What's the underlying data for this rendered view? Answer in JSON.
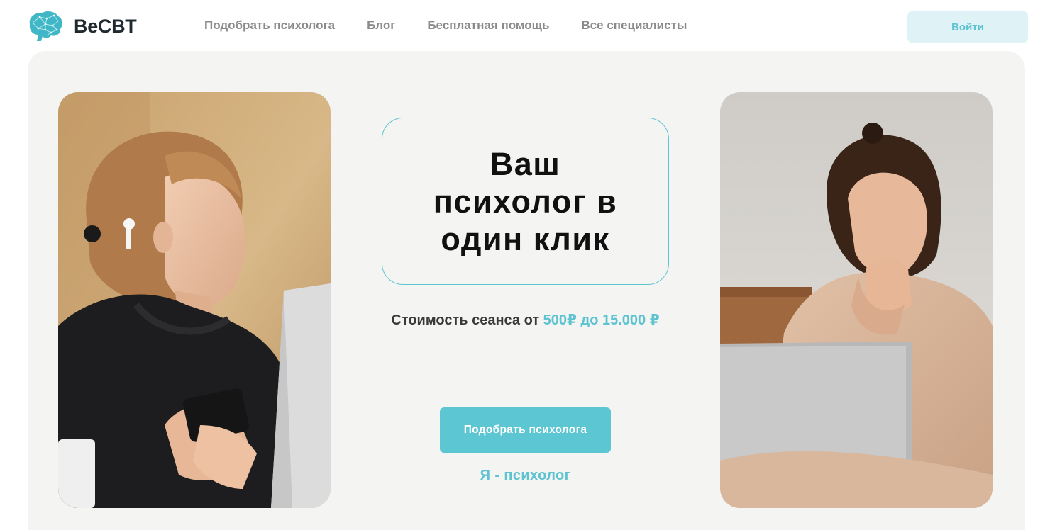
{
  "brand": {
    "name": "BeCBT",
    "logo_icon": "brain-icon",
    "accent_color": "#5cc3d1"
  },
  "nav": {
    "items": [
      {
        "label": "Подобрать психолога"
      },
      {
        "label": "Блог"
      },
      {
        "label": "Бесплатная помощь"
      },
      {
        "label": "Все специалисты"
      }
    ]
  },
  "header": {
    "login_label": "Войти"
  },
  "hero": {
    "headline": "Ваш психолог в один клик",
    "price_prefix": "Стоимость сеанса от",
    "price_range": "500₽ до 15.000 ₽",
    "cta_label": "Подобрать психолога",
    "psychologist_link": "Я - психолог",
    "left_photo": "woman-with-phone-photo",
    "right_photo": "woman-with-laptop-photo"
  }
}
